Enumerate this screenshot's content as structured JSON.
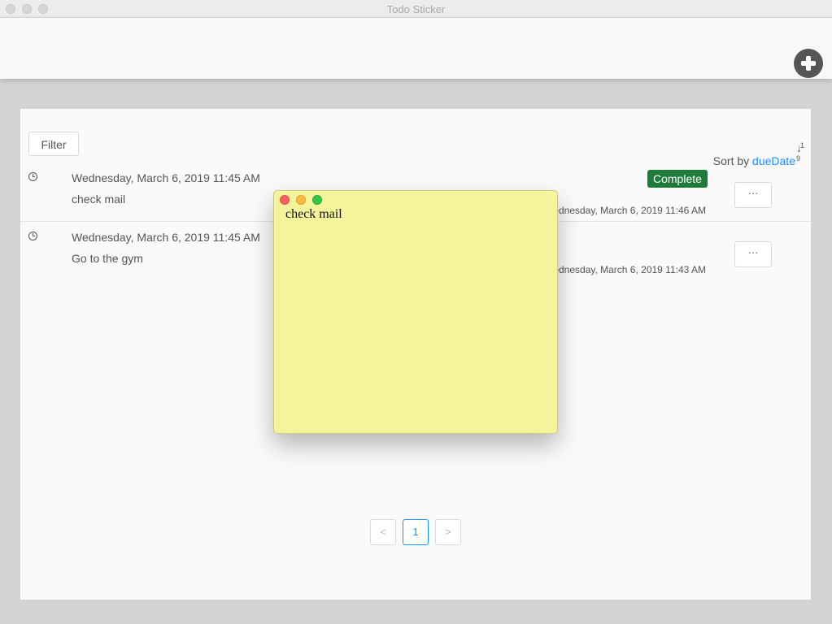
{
  "window": {
    "title": "Todo Sticker"
  },
  "toolbar": {
    "add_icon": "plus-circle-icon"
  },
  "list": {
    "filter_label": "Filter",
    "sort_prefix": "Sort by",
    "sort_field": "dueDate",
    "sort_icon": "sort-numeric-descending-icon",
    "items": [
      {
        "due": "Wednesday, March 6, 2019 11:45 AM",
        "text": "check mail",
        "status": "Complete",
        "updated": "Wednesday, March 6, 2019 11:46 AM",
        "more": "···"
      },
      {
        "due": "Wednesday, March 6, 2019 11:45 AM",
        "text": "Go to the gym",
        "updated": "Wednesday, March 6, 2019 11:43 AM",
        "more": "···"
      }
    ]
  },
  "pagination": {
    "prev": "<",
    "current": "1",
    "next": ">"
  },
  "sticker": {
    "text": "check mail"
  },
  "colors": {
    "sticker_bg": "#f5f49a",
    "badge_complete": "#1e7b3a",
    "accent": "#1890ff"
  }
}
